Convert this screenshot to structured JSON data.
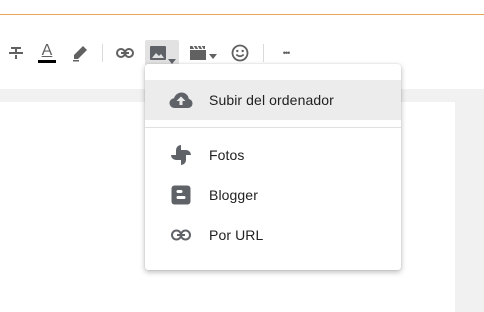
{
  "colors": {
    "accent_border": "#e8a65a",
    "icon_gray": "#616161",
    "text_color": "#212121"
  },
  "toolbar": {
    "icons": [
      "strikethrough-icon",
      "text-color-icon",
      "highlight-pen-icon",
      "link-icon",
      "insert-image-icon",
      "insert-video-icon",
      "emoji-icon",
      "more-options-icon"
    ],
    "text_color_glyph": "A",
    "more_glyph": "•••"
  },
  "image_menu": {
    "items": [
      {
        "label": "Subir del ordenador",
        "icon": "cloud-upload-icon",
        "highlighted": true
      },
      {
        "label": "Fotos",
        "icon": "photos-pinwheel-icon",
        "highlighted": false
      },
      {
        "label": "Blogger",
        "icon": "blogger-icon",
        "highlighted": false
      },
      {
        "label": "Por URL",
        "icon": "link-icon",
        "highlighted": false
      }
    ]
  }
}
